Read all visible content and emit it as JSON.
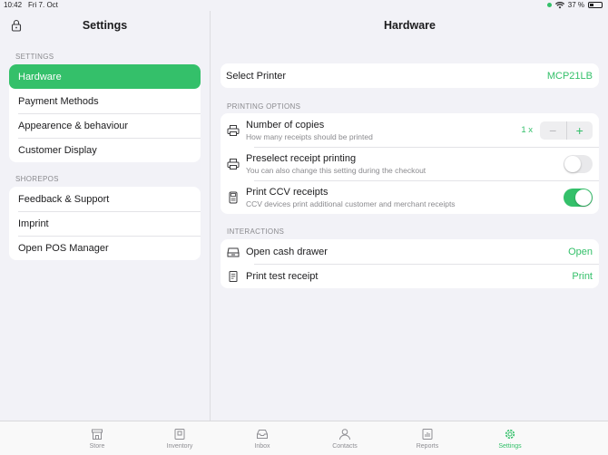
{
  "status_bar": {
    "time": "10:42",
    "date": "Fri 7. Oct",
    "battery": "37 %",
    "battery_level": 0.37
  },
  "sidebar": {
    "title": "Settings",
    "sections": [
      {
        "label": "SETTINGS",
        "items": [
          {
            "label": "Hardware",
            "active": true
          },
          {
            "label": "Payment Methods"
          },
          {
            "label": "Appearence & behaviour"
          },
          {
            "label": "Customer Display"
          }
        ]
      },
      {
        "label": "SHOREPOS",
        "items": [
          {
            "label": "Feedback & Support"
          },
          {
            "label": "Imprint"
          },
          {
            "label": "Open POS Manager"
          }
        ]
      }
    ]
  },
  "main": {
    "title": "Hardware",
    "printer": {
      "label": "Select Printer",
      "value": "MCP21LB"
    },
    "printing_options": {
      "label": "PRINTING OPTIONS",
      "copies": {
        "title": "Number of copies",
        "subtitle": "How many receipts should be printed",
        "count": "1 x",
        "minus": "−",
        "plus": "+"
      },
      "preselect": {
        "title": "Preselect receipt printing",
        "subtitle": "You can also change this setting during the checkout",
        "enabled": false
      },
      "ccv": {
        "title": "Print CCV receipts",
        "subtitle": "CCV devices print additional customer and merchant receipts",
        "enabled": true
      }
    },
    "interactions": {
      "label": "INTERACTIONS",
      "cash_drawer": {
        "title": "Open cash drawer",
        "action": "Open"
      },
      "test_receipt": {
        "title": "Print test receipt",
        "action": "Print"
      }
    }
  },
  "tabbar": {
    "tabs": [
      {
        "label": "Store",
        "icon": "store-icon"
      },
      {
        "label": "Inventory",
        "icon": "inventory-icon"
      },
      {
        "label": "Inbox",
        "icon": "inbox-icon"
      },
      {
        "label": "Contacts",
        "icon": "contacts-icon"
      },
      {
        "label": "Reports",
        "icon": "reports-icon"
      },
      {
        "label": "Settings",
        "icon": "gear-icon",
        "active": true
      }
    ]
  },
  "colors": {
    "accent": "#34c06a",
    "background": "#f2f2f7",
    "card": "#ffffff",
    "secondary_text": "#8a8a8e"
  }
}
